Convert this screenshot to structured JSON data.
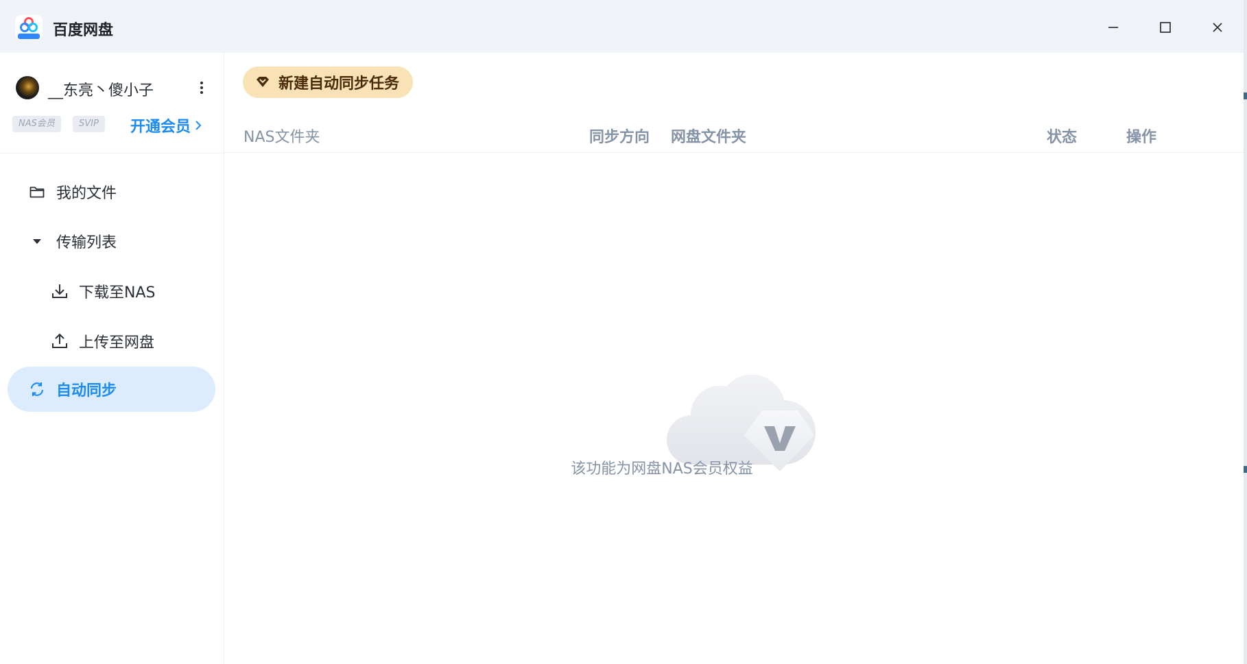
{
  "window": {
    "title": "百度网盘"
  },
  "sidebar": {
    "user": {
      "name": "__东亮丶傻小子",
      "badges": [
        "NAS会员",
        "SVIP"
      ],
      "open_vip_label": "开通会员"
    },
    "nav": {
      "my_files": "我的文件",
      "transfer_list": "传输列表",
      "download_to_nas": "下载至NAS",
      "upload_to_cloud": "上传至网盘",
      "auto_sync": "自动同步"
    },
    "selected": "auto_sync"
  },
  "main": {
    "new_task_label": "新建自动同步任务",
    "columns": {
      "nas_folder": "NAS文件夹",
      "sync_direction": "同步方向",
      "cloud_folder": "网盘文件夹",
      "status": "状态",
      "action": "操作"
    },
    "empty_message": "该功能为网盘NAS会员权益"
  },
  "colors": {
    "accent": "#1c8cf0",
    "selected_bg": "#dcecfd",
    "vip_button_bg": "#f9e2b6",
    "vip_button_text": "#4a2c0b",
    "muted_text": "#8593a6"
  },
  "icons": {
    "app": "baidu-netdisk-logo",
    "minimize": "minimize-icon",
    "maximize": "maximize-icon",
    "close": "close-icon",
    "more": "more-vertical-icon",
    "my_files": "folder-icon",
    "transfer_list": "caret-down-icon",
    "download": "download-icon",
    "upload": "upload-icon",
    "auto_sync": "sync-icon",
    "new_task": "diamond-vip-icon",
    "empty": "vip-cloud-illustration"
  }
}
